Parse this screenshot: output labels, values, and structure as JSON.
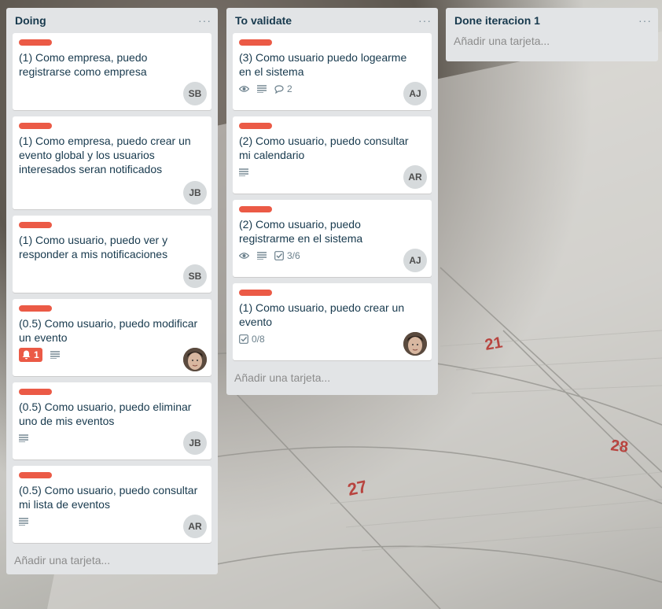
{
  "lists": [
    {
      "title": "Doing",
      "menu": "···",
      "add_card": "Añadir una tarjeta...",
      "cards": [
        {
          "title": "(1) Como empresa, puedo registrarse como empresa",
          "member": "SB"
        },
        {
          "title": "(1) Como empresa, puedo crear un evento global y los usuarios interesados seran notificados",
          "member": "JB"
        },
        {
          "title": "(1) Como usuario, puedo ver y responder a mis notificaciones",
          "member": "SB"
        },
        {
          "title": "(0.5) Como usuario, puedo modificar un evento",
          "notifications": "1",
          "member_avatar": "user-photo"
        },
        {
          "title": "(0.5) Como usuario, puedo eliminar uno de mis eventos",
          "member": "JB"
        },
        {
          "title": "(0.5) Como usuario, puedo consultar mi lista de eventos",
          "member": "AR"
        }
      ]
    },
    {
      "title": "To validate",
      "menu": "···",
      "add_card": "Añadir una tarjeta...",
      "cards": [
        {
          "title": "(3) Como usuario puedo logearme en el sistema",
          "comments": "2",
          "member": "AJ"
        },
        {
          "title": "(2) Como usuario, puedo consultar mi calendario",
          "member": "AR"
        },
        {
          "title": "(2) Como usuario, puedo registrarme en el sistema",
          "checklist": "3/6",
          "member": "AJ"
        },
        {
          "title": "(1) Como usuario, puedo crear un evento",
          "checklist": "0/8",
          "member_avatar": "user-photo"
        }
      ]
    },
    {
      "title": "Done iteracion 1",
      "menu": "···",
      "add_card": "Añadir una tarjeta..."
    }
  ],
  "background": {
    "calendar_dates": [
      "21",
      "27",
      "28"
    ]
  },
  "colors": {
    "label": "#eb5a46",
    "list_bg": "#e2e4e6",
    "card_bg": "#ffffff",
    "title_text": "#17394d",
    "badge_text": "#6b808c",
    "calendar_date": "#b8443f"
  }
}
